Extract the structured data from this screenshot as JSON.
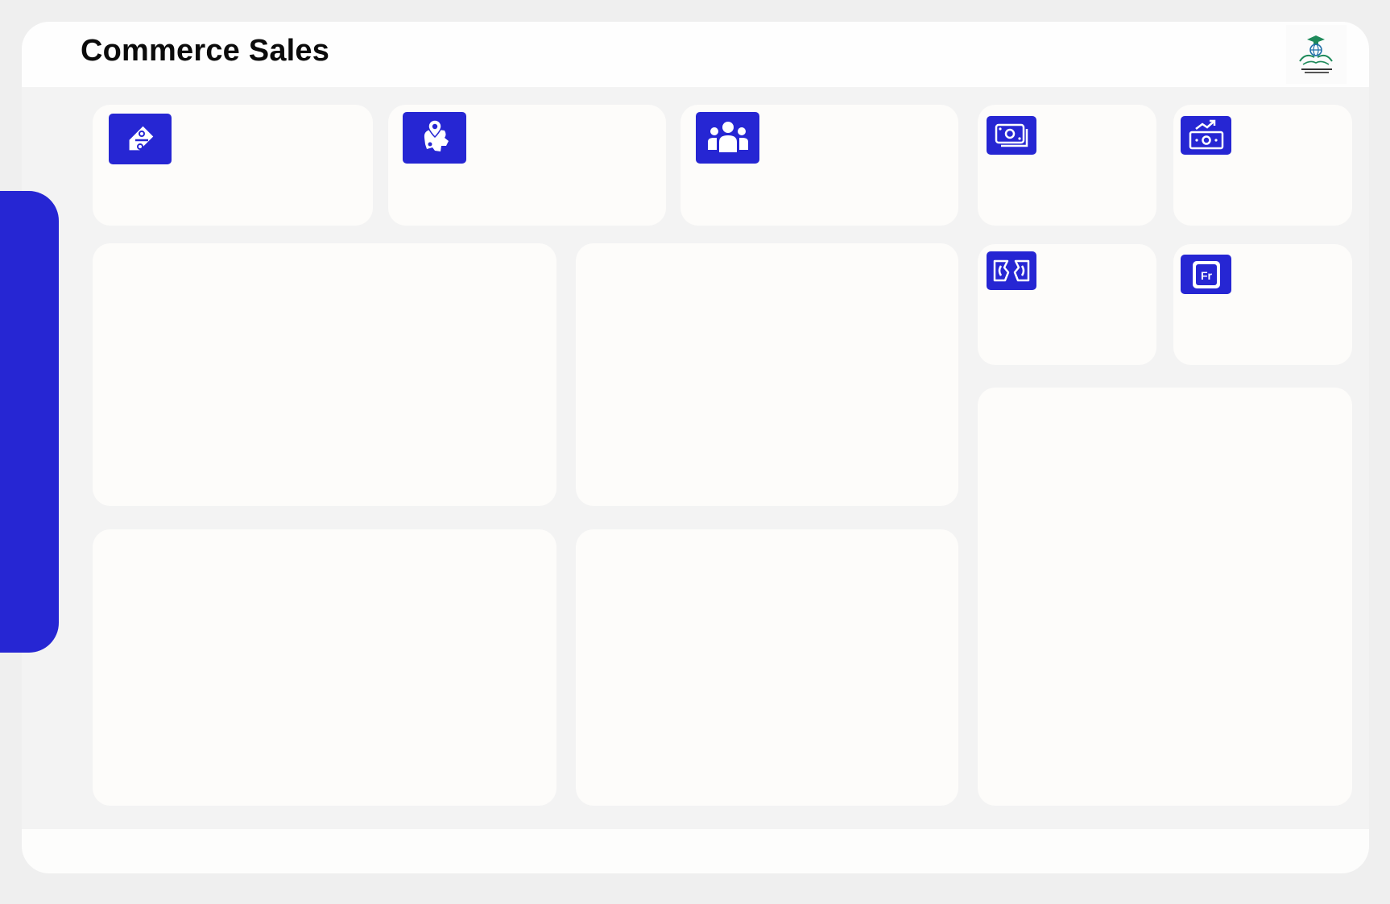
{
  "header": {
    "title": "Commerce Sales",
    "logo_icon": "org-logo-icon"
  },
  "theme": {
    "accent": "#2626d3",
    "card_background": "#fdfcfa",
    "page_background": "#efefef",
    "panel_background": "#f3f3f3",
    "header_background": "#fefefe",
    "logo_green": "#1e8a5a"
  },
  "kpi_cards": [
    {
      "id": "discount",
      "icon": "discount-tag-icon"
    },
    {
      "id": "region",
      "icon": "map-location-icon"
    },
    {
      "id": "customers",
      "icon": "users-group-icon"
    },
    {
      "id": "sales",
      "icon": "money-bill-icon"
    },
    {
      "id": "profit",
      "icon": "money-trend-up-icon"
    },
    {
      "id": "loss",
      "icon": "money-exchange-icon"
    },
    {
      "id": "currency",
      "icon": "franc-currency-icon"
    }
  ],
  "chart_panels": [
    {
      "id": "panel-1"
    },
    {
      "id": "panel-2"
    },
    {
      "id": "panel-3"
    },
    {
      "id": "panel-4"
    },
    {
      "id": "panel-5"
    }
  ],
  "side_tab": {
    "icon": "navigation-tab"
  }
}
